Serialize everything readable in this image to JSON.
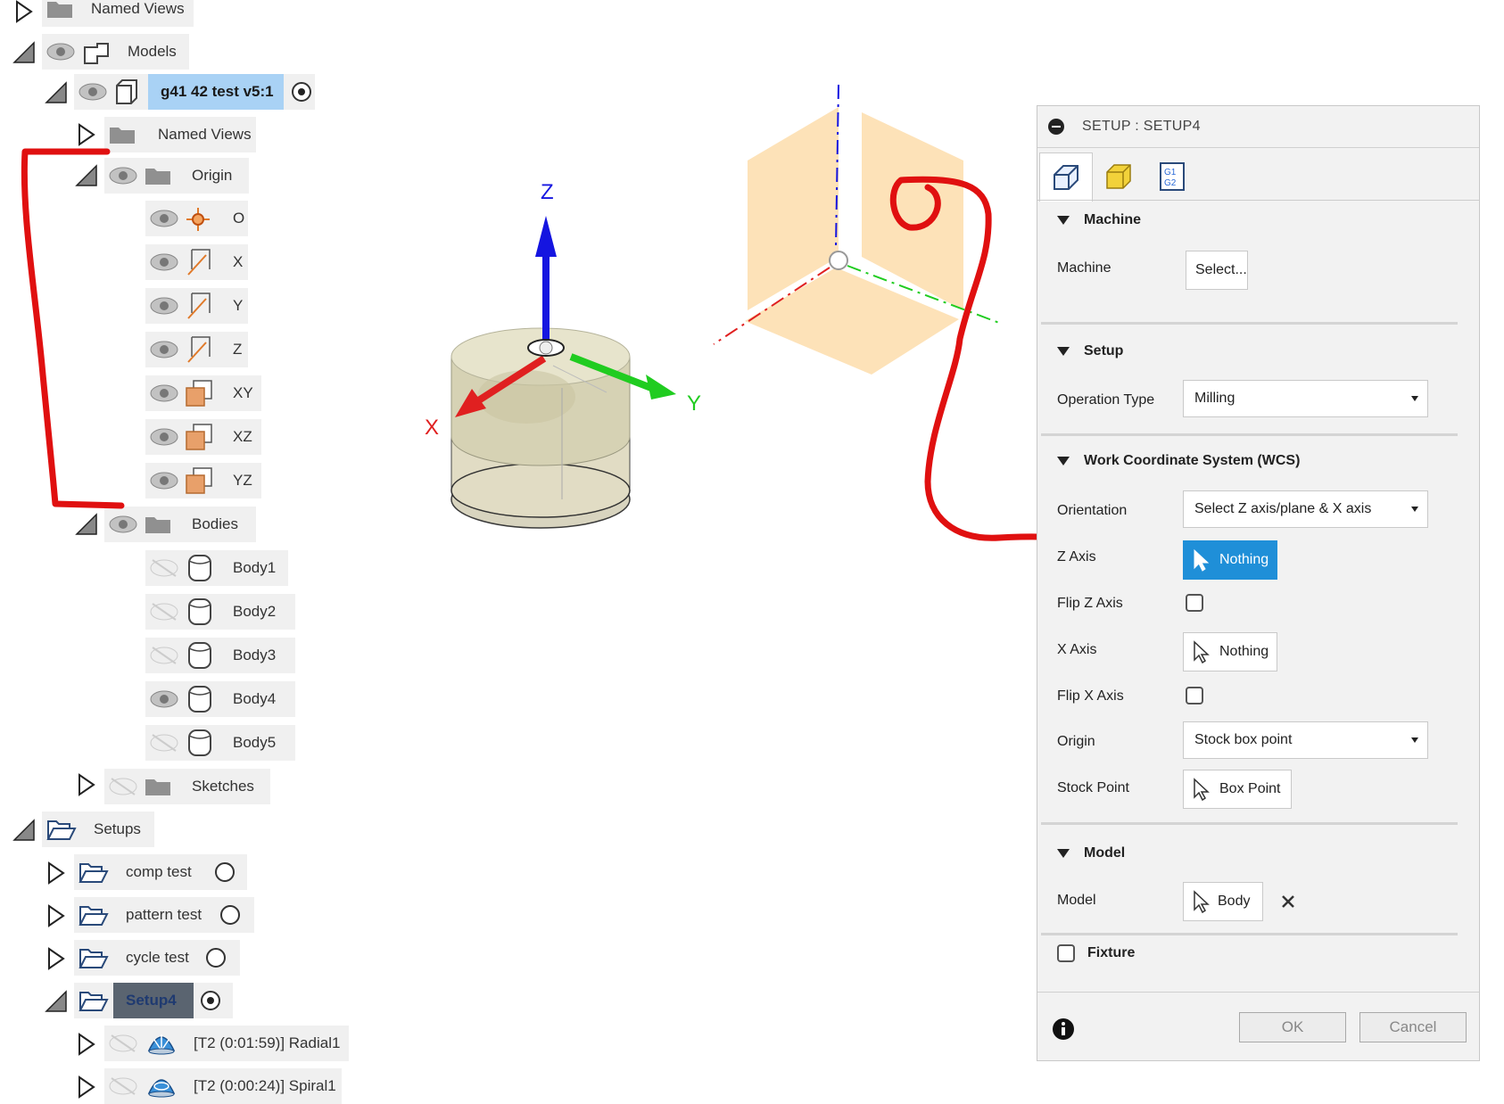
{
  "tree": {
    "named_views_top": "Named Views",
    "models": "Models",
    "component": "g41 42 test v5:1",
    "named_views": "Named Views",
    "origin": "Origin",
    "origin_items": [
      "O",
      "X",
      "Y",
      "Z",
      "XY",
      "XZ",
      "YZ"
    ],
    "bodies": "Bodies",
    "body_items": [
      "Body1",
      "Body2",
      "Body3",
      "Body4",
      "Body5"
    ],
    "sketches": "Sketches",
    "setups": "Setups",
    "setup_items": [
      "comp test",
      "pattern test",
      "cycle test",
      "Setup4"
    ],
    "operations": [
      "[T2 (0:01:59)] Radial1",
      "[T2 (0:00:24)] Spiral1"
    ]
  },
  "viewport": {
    "axis_z": "Z",
    "axis_x": "X",
    "axis_y": "Y"
  },
  "panel": {
    "title": "SETUP : SETUP4",
    "machine_section": "Machine",
    "machine_label": "Machine",
    "machine_value": "Select...",
    "setup_section": "Setup",
    "operation_type_label": "Operation Type",
    "operation_type_value": "Milling",
    "wcs_section": "Work Coordinate System (WCS)",
    "orientation_label": "Orientation",
    "orientation_value": "Select Z axis/plane & X axis",
    "z_axis_label": "Z Axis",
    "z_axis_value": "Nothing",
    "flip_z_label": "Flip Z Axis",
    "x_axis_label": "X Axis",
    "x_axis_value": "Nothing",
    "flip_x_label": "Flip X Axis",
    "origin_label": "Origin",
    "origin_value": "Stock box point",
    "stock_point_label": "Stock Point",
    "stock_point_value": "Box Point",
    "model_section": "Model",
    "model_label": "Model",
    "model_value": "Body",
    "fixture_label": "Fixture",
    "ok": "OK",
    "cancel": "Cancel"
  },
  "colors": {
    "accent_blue": "#1f8fd8",
    "selected_node": "#a9d2f5",
    "active_setup": "#5a6470",
    "annotation_red": "#e01010",
    "axis_red": "#e02020",
    "axis_green": "#20cc20",
    "axis_blue": "#1515e0",
    "plane_orange": "#fde2b8"
  }
}
